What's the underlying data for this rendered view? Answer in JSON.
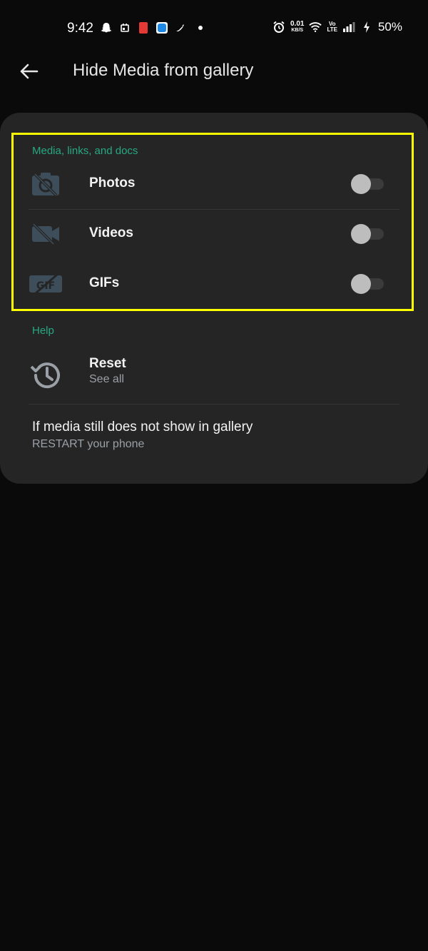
{
  "status_bar": {
    "time": "9:42",
    "net_speed_value": "0.01",
    "net_speed_unit": "KB/S",
    "volte_line1": "Vo",
    "volte_line2": "LTE",
    "battery": "50%"
  },
  "app_bar": {
    "title": "Hide Media from gallery"
  },
  "media_section": {
    "header": "Media, links, and docs",
    "items": [
      {
        "label": "Photos",
        "icon": "photo-off-icon",
        "enabled": false
      },
      {
        "label": "Videos",
        "icon": "video-off-icon",
        "enabled": false
      },
      {
        "label": "GIFs",
        "icon": "gif-off-icon",
        "enabled": false
      }
    ]
  },
  "help_section": {
    "header": "Help",
    "reset_title": "Reset",
    "reset_sub": "See all",
    "info_title": "If media still does not show in gallery",
    "info_sub": "RESTART your phone"
  },
  "colors": {
    "accent": "#27a982",
    "highlight": "#ffff00",
    "card": "#252525",
    "background": "#0a0a0a"
  }
}
